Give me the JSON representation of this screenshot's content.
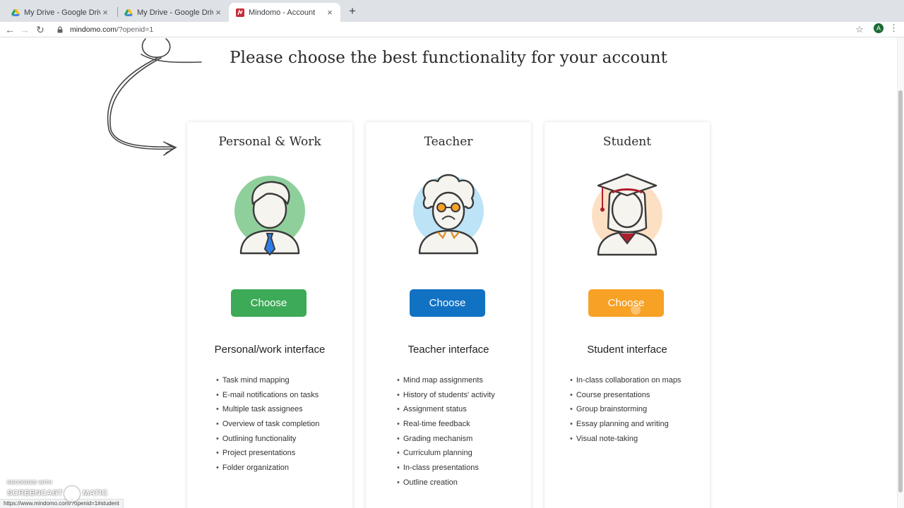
{
  "browser": {
    "tabs": [
      {
        "title": "My Drive - Google Drive",
        "icon": "google-drive-icon",
        "active": false
      },
      {
        "title": "My Drive - Google Drive",
        "icon": "google-drive-icon",
        "active": false
      },
      {
        "title": "Mindomo - Account",
        "icon": "mindomo-icon",
        "active": true
      }
    ],
    "new_tab": "+",
    "address": {
      "host": "mindomo.com",
      "path": "/?openid=1"
    },
    "profile_initial": "A",
    "status_url": "https://www.mindomo.com/?openid=1#student"
  },
  "page": {
    "heading": "Please choose the best functionality for your account",
    "cards": [
      {
        "title": "Personal & Work",
        "button": "Choose",
        "button_color": "#3daa57",
        "avatar_color": "#8fcf9c",
        "interface": "Personal/work interface",
        "features": [
          "Task mind mapping",
          "E-mail notifications on tasks",
          "Multiple task assignees",
          "Overview of task completion",
          "Outlining functionality",
          "Project presentations",
          "Folder organization"
        ]
      },
      {
        "title": "Teacher",
        "button": "Choose",
        "button_color": "#1172c4",
        "avatar_color": "#bde3f7",
        "interface": "Teacher interface",
        "features": [
          "Mind map assignments",
          "History of students' activity",
          "Assignment status",
          "Real-time feedback",
          "Grading mechanism",
          "Curriculum planning",
          "In-class presentations",
          "Outline creation"
        ]
      },
      {
        "title": "Student",
        "button": "Choose",
        "button_color": "#f7a125",
        "avatar_color": "#fde0c4",
        "interface": "Student interface",
        "features": [
          "In-class collaboration on maps",
          "Course presentations",
          "Group brainstorming",
          "Essay planning and writing",
          "Visual note-taking"
        ]
      }
    ]
  },
  "watermark": {
    "line1": "RECORDED WITH",
    "line2a": "SCREENCAST",
    "line2b": "MATIC"
  }
}
